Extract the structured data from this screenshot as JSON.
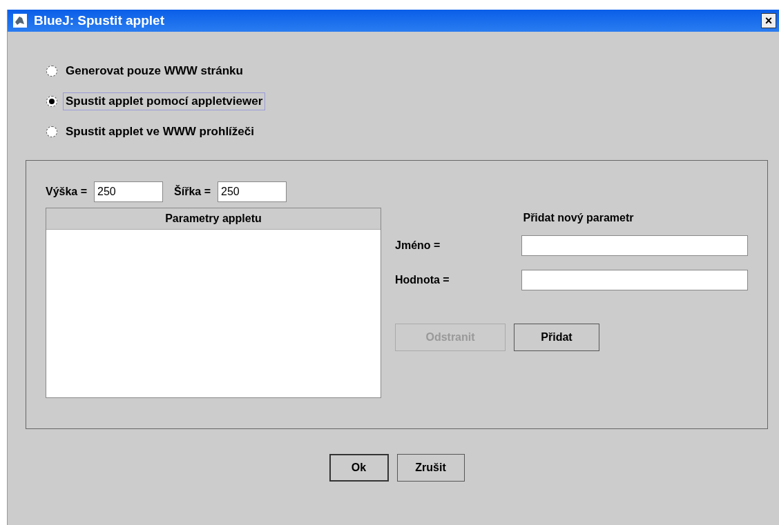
{
  "window": {
    "title": "BlueJ:  Spustit applet",
    "close": "×"
  },
  "modes": [
    {
      "label": "Generovat pouze WWW stránku",
      "selected": false,
      "focused": false
    },
    {
      "label": "Spustit applet pomocí appletviewer",
      "selected": true,
      "focused": true
    },
    {
      "label": "Spustit applet ve WWW prohlížeči",
      "selected": false,
      "focused": false
    }
  ],
  "size": {
    "height_label": "Výška =",
    "height_value": "250",
    "width_label": "Šířka =",
    "width_value": "250"
  },
  "table": {
    "columns": [
      "Parametry appletu"
    ]
  },
  "new_param": {
    "title": "Přidat nový parametr",
    "fields": [
      {
        "label": "Jméno ="
      },
      {
        "label": "Hodnota ="
      }
    ],
    "buttons": [
      {
        "label": "Odstranit",
        "disabled": true
      },
      {
        "label": "Přidat",
        "disabled": false
      }
    ]
  },
  "buttons": [
    {
      "label": "Ok",
      "default": true
    },
    {
      "label": "Zrušit",
      "default": false
    }
  ]
}
